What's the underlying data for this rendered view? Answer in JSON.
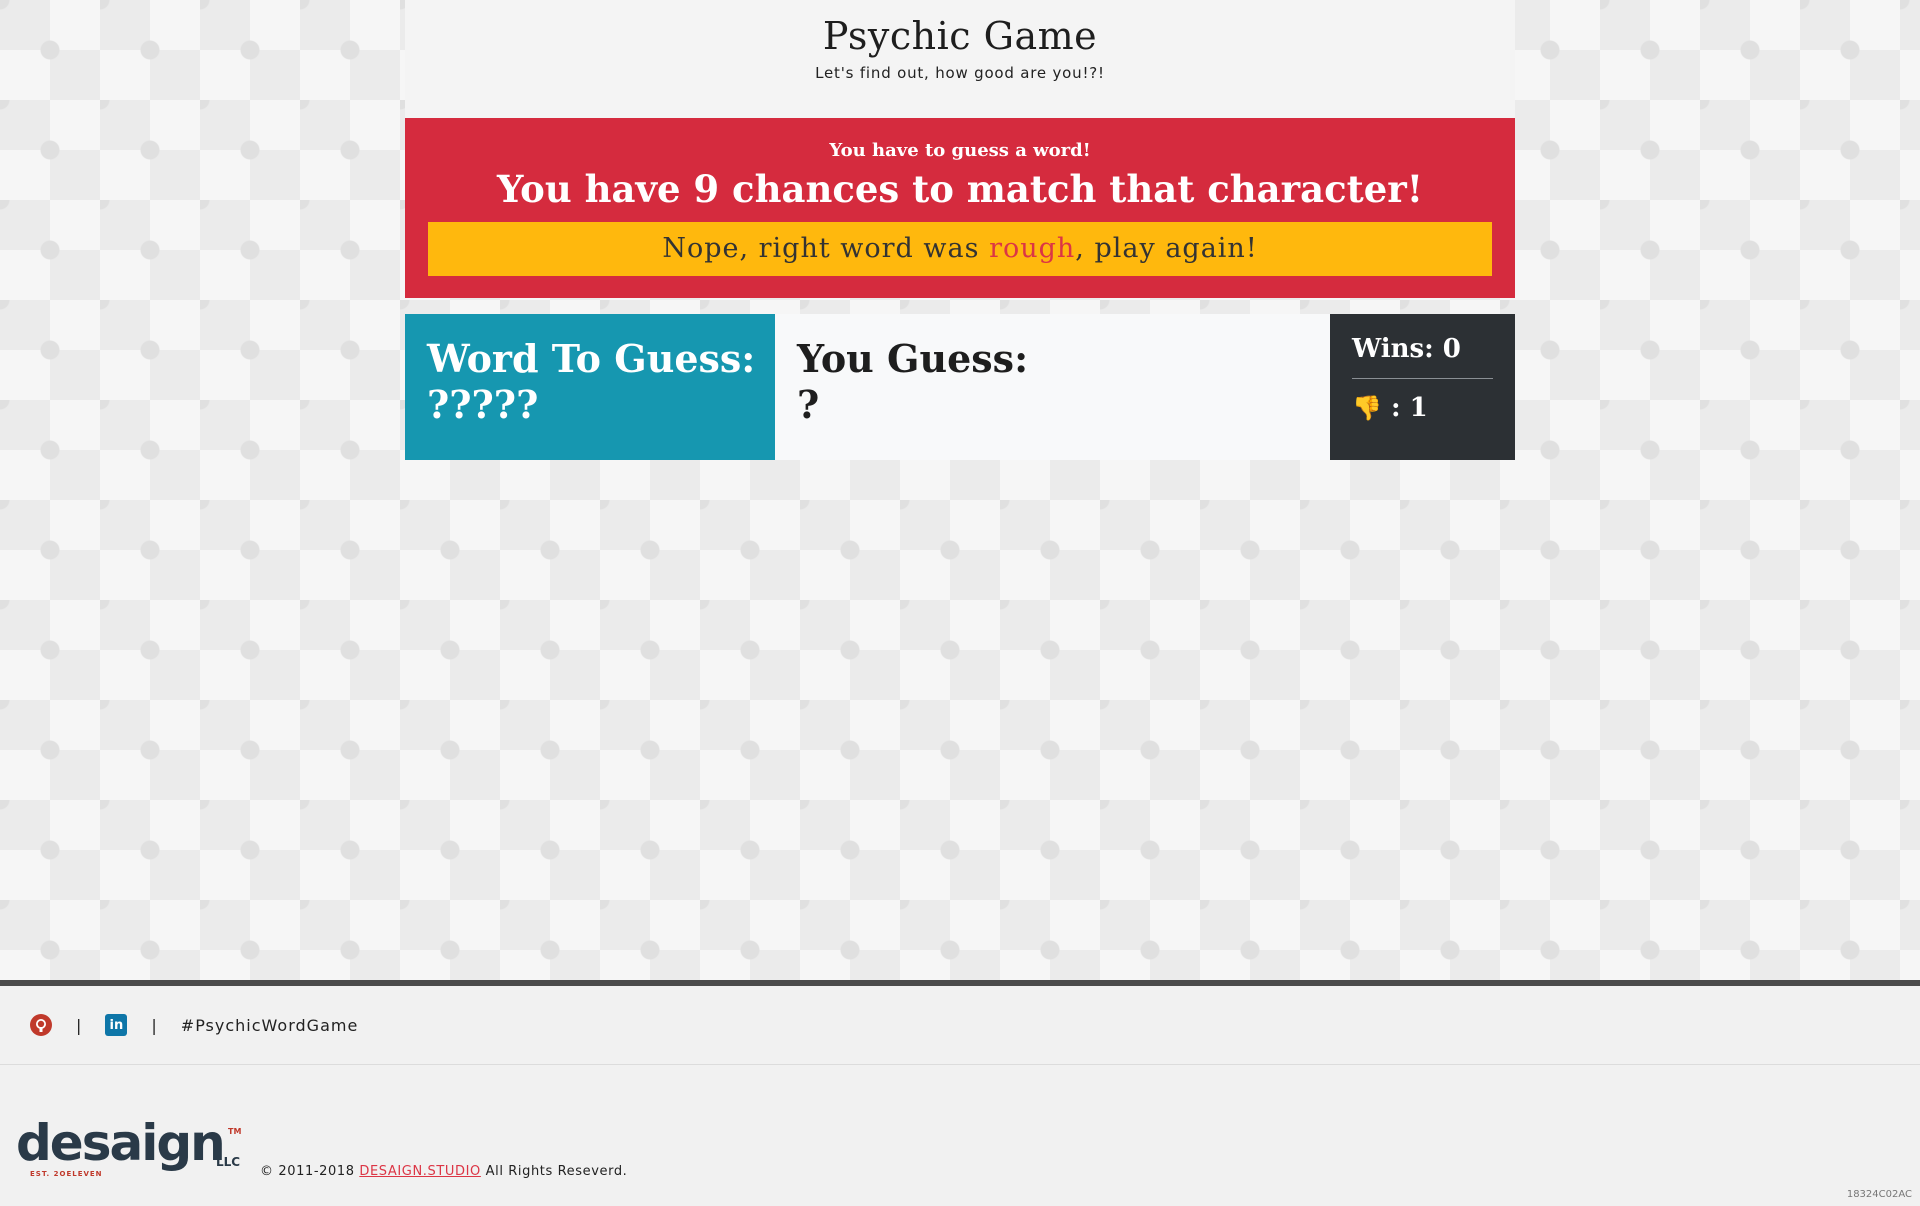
{
  "header": {
    "title": "Psychic Game",
    "subtitle": "Let's find out, how good are you!?!"
  },
  "banner": {
    "instruction": "You have to guess a word!",
    "chances": "You have 9 chances to match that character!",
    "alert_prefix": "Nope, right word was ",
    "alert_word": "rough",
    "alert_suffix": ", play again!"
  },
  "word_box": {
    "label": "Word To Guess:",
    "value": "?????"
  },
  "guess_box": {
    "label": "You Guess:",
    "value": "?"
  },
  "score": {
    "wins_label": "Wins: 0",
    "losses_icon": "👎",
    "losses_text": ": 1"
  },
  "footer": {
    "social_icons": [
      "github-icon",
      "linkedin-icon"
    ],
    "separator": "|",
    "hashtag": "#PsychicWordGame",
    "logo_text": "desaign",
    "logo_sub": "EST. 2OELEVEN",
    "logo_llc": "LLC",
    "logo_tm": "TM",
    "copyright_prefix": "© 2011-2018 ",
    "copyright_link": "DESAIGN.STUDIO",
    "copyright_suffix": " All Rights Reseverd.",
    "corner_code": "18324C02AC"
  },
  "colors": {
    "banner": "#d52b3e",
    "alert": "#ffb80d",
    "word_box": "#1697b0",
    "score_box": "#2c3034",
    "accent_red": "#dc3545"
  }
}
